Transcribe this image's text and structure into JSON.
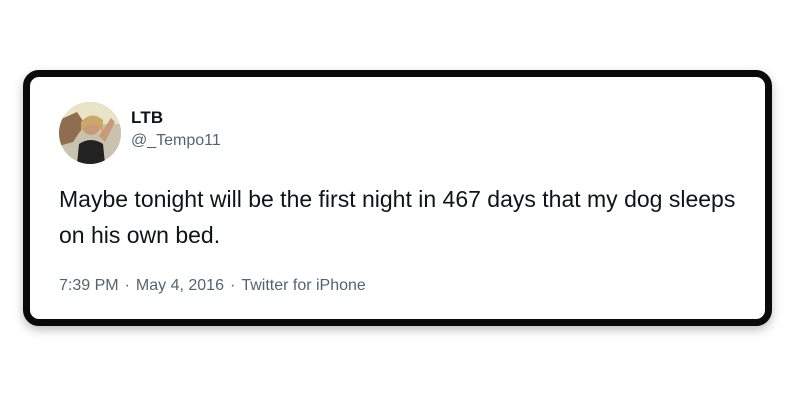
{
  "tweet": {
    "author": {
      "name": "LTB",
      "handle": "@_Tempo11",
      "avatar_icon": "profile-photo"
    },
    "text": "Maybe tonight will be the first night in 467 days that my dog sleeps on his own bed.",
    "meta": {
      "time": "7:39 PM",
      "separator": "·",
      "date": "May 4, 2016",
      "source": "Twitter for iPhone"
    }
  },
  "colors": {
    "border": "#0a0a0a",
    "text_primary": "#0f1419",
    "text_secondary": "#536471",
    "background": "#ffffff"
  }
}
